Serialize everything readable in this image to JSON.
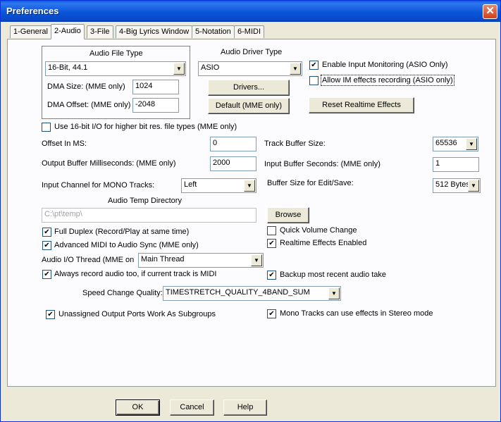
{
  "window": {
    "title": "Preferences",
    "close_glyph": "✕"
  },
  "tabs": [
    {
      "label": "1-General"
    },
    {
      "label": "2-Audio"
    },
    {
      "label": "3-File"
    },
    {
      "label": "4-Big Lyrics Window"
    },
    {
      "label": "5-Notation"
    },
    {
      "label": "6-MIDI"
    }
  ],
  "audio_file_type": {
    "group_label": "Audio File Type",
    "format_value": "16-Bit, 44.1",
    "dma_size_label": "DMA Size: (MME only)",
    "dma_size_value": "1024",
    "dma_offset_label": "DMA Offset: (MME only)",
    "dma_offset_value": "-2048"
  },
  "audio_driver": {
    "label": "Audio Driver Type",
    "value": "ASIO",
    "drivers_button": "Drivers...",
    "default_button": "Default (MME only)"
  },
  "options_right": {
    "enable_input_monitoring": "Enable Input Monitoring (ASIO Only)",
    "allow_im_effects": "Allow IM effects recording (ASIO only)",
    "reset_button": "Reset Realtime Effects"
  },
  "use_16bit": "Use 16-bit I/O for higher bit res. file types (MME only)",
  "fields": {
    "offset_ms_label": "Offset In MS:",
    "offset_ms_value": "0",
    "output_buffer_label": "Output Buffer Milliseconds: (MME only)",
    "output_buffer_value": "2000",
    "input_channel_label": "Input Channel for MONO Tracks:",
    "input_channel_value": "Left",
    "track_buffer_label": "Track Buffer Size:",
    "track_buffer_value": "65536",
    "input_buffer_label": "Input Buffer Seconds: (MME only)",
    "input_buffer_value": "1",
    "buffer_edit_label": "Buffer Size for Edit/Save:",
    "buffer_edit_value": "512 Bytes"
  },
  "temp_dir": {
    "label": "Audio Temp Directory",
    "value": "C:\\pt\\temp\\",
    "browse_button": "Browse"
  },
  "checks": {
    "full_duplex": "Full Duplex (Record/Play at same time)",
    "advanced_midi": "Advanced MIDI to Audio Sync (MME only)",
    "always_record": "Always record audio too, if current track is MIDI",
    "quick_volume": "Quick Volume Change",
    "realtime_effects": "Realtime Effects Enabled",
    "backup_take": "Backup most recent audio take",
    "unassigned_ports": "Unassigned Output Ports Work As Subgroups",
    "mono_tracks": "Mono Tracks can use effects in Stereo mode"
  },
  "io_thread": {
    "label": "Audio I/O Thread (MME on",
    "value": "Main Thread"
  },
  "speed_change": {
    "label": "Speed Change Quality:",
    "value": "TIMESTRETCH_QUALITY_4BAND_SUM"
  },
  "footer": {
    "ok": "OK",
    "cancel": "Cancel",
    "help": "Help"
  },
  "icons": {
    "dropdown_arrow": "▼",
    "check": "✔"
  }
}
